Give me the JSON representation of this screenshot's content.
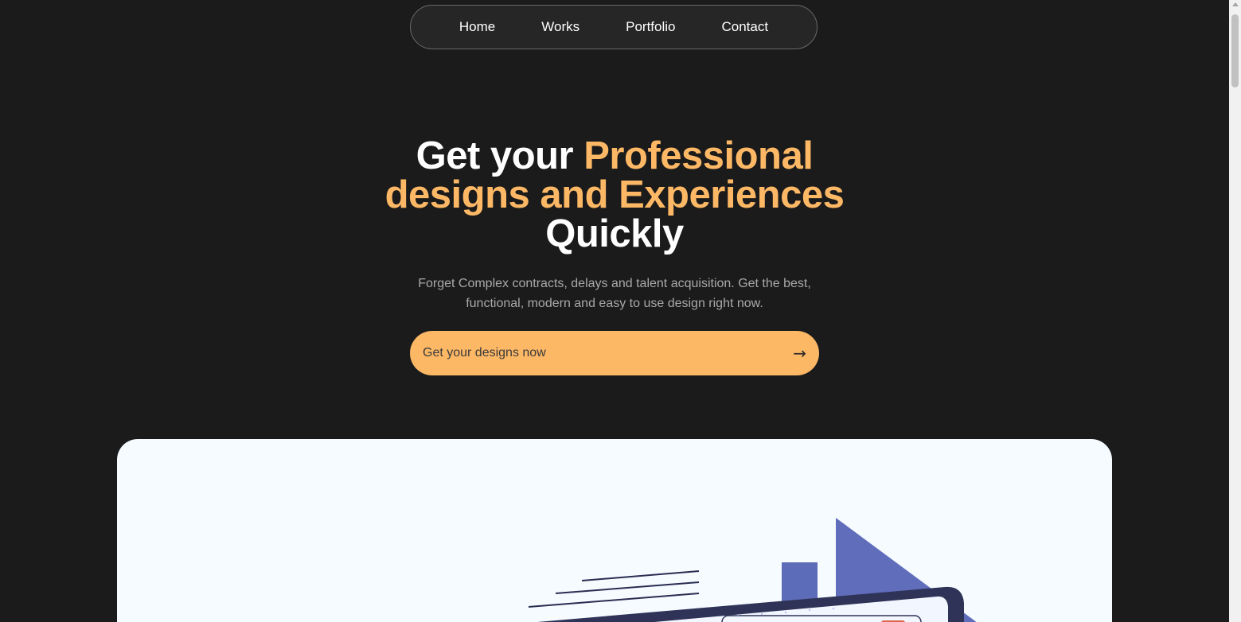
{
  "nav": {
    "items": [
      {
        "label": "Home"
      },
      {
        "label": "Works"
      },
      {
        "label": "Portfolio"
      },
      {
        "label": "Contact"
      }
    ]
  },
  "hero": {
    "title_part1": "Get your ",
    "title_accent1": "Professional designs and Experiences",
    "title_part2": " Quickly",
    "subtitle": "Forget Complex contracts, delays and talent acquisition. Get the best, functional, modern and easy to use design right now.",
    "cta_label": "Get your designs now",
    "cta_arrow": "→"
  },
  "colors": {
    "background": "#1b1b1b",
    "accent": "#fdb866",
    "card": "#f5fbff",
    "illustration_blue": "#5a6ab8",
    "illustration_dark": "#2f3357"
  },
  "showcase": {
    "illustration": "design-illustration"
  }
}
